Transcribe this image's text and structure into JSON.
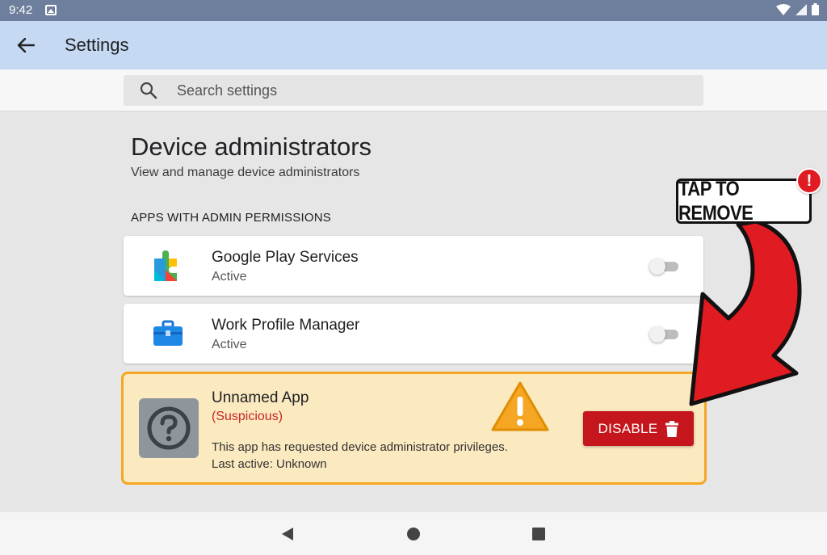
{
  "status_bar": {
    "time": "9:42"
  },
  "app_bar": {
    "title": "Settings"
  },
  "search": {
    "placeholder": "Search settings"
  },
  "page": {
    "title": "Device administrators",
    "subtitle": "View and manage device administrators",
    "section_header": "APPS WITH ADMIN PERMISSIONS"
  },
  "apps": [
    {
      "name": "Google Play Services",
      "status": "Active",
      "icon": "google-play-services-icon"
    },
    {
      "name": "Work Profile Manager",
      "status": "Active",
      "icon": "briefcase-icon"
    }
  ],
  "suspicious_app": {
    "name": "Unnamed App",
    "tag": "(Suspicious)",
    "description": "This app has requested device administrator privileges.",
    "last_active": "Last active: Unknown",
    "disable_label": "DISABLE"
  },
  "callout": {
    "label": "TAP TO REMOVE",
    "badge": "!"
  },
  "colors": {
    "status_bar": "#6d7f9c",
    "app_bar": "#c5d9f3",
    "warning_border": "#f5a623",
    "warning_bg": "#fbe9c0",
    "danger": "#c4161c",
    "suspicious_text": "#c62828",
    "arrow_red": "#e01b22"
  }
}
